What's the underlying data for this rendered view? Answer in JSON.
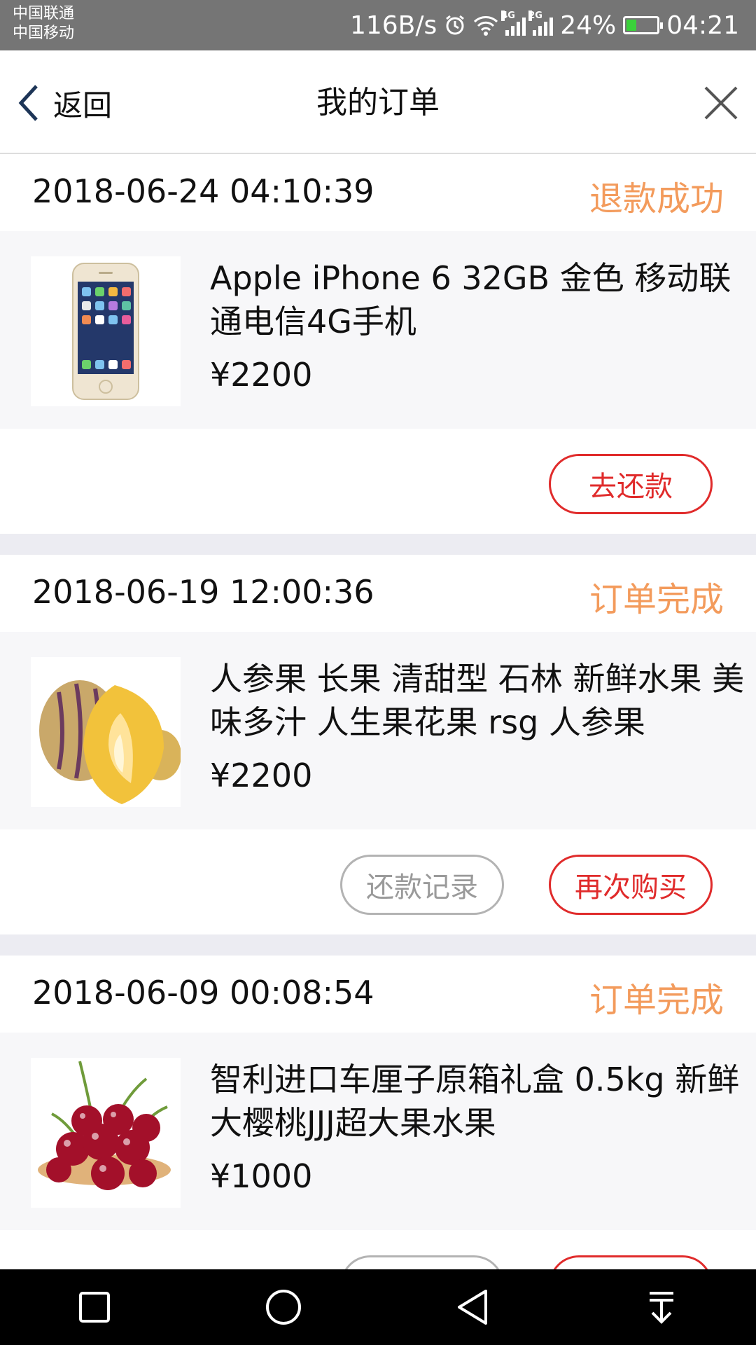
{
  "status_bar": {
    "carrier1": "中国联通",
    "carrier2": "中国移动",
    "net_speed": "116B/s",
    "net1": "4G",
    "net2": "2G",
    "battery": "24%",
    "time": "04:21"
  },
  "nav": {
    "back_label": "返回",
    "title": "我的订单"
  },
  "orders": [
    {
      "time": "2018-06-24 04:10:39",
      "status": "退款成功",
      "product_name": "Apple iPhone 6 32GB 金色 移动联通电信4G手机",
      "price": "¥2200",
      "image": "iphone-image",
      "actions": [
        "去还款"
      ]
    },
    {
      "time": "2018-06-19 12:00:36",
      "status": "订单完成",
      "product_name": "人参果 长果 清甜型 石林 新鲜水果 美味多汁 人生果花果 rsg 人参果",
      "price": "¥2200",
      "image": "pepino-fruit-image",
      "actions": [
        "还款记录",
        "再次购买"
      ]
    },
    {
      "time": "2018-06-09 00:08:54",
      "status": "订单完成",
      "product_name": "智利进口车厘子原箱礼盒 0.5kg 新鲜大樱桃JJJ超大果水果",
      "price": "¥1000",
      "image": "cherries-image",
      "actions": []
    }
  ],
  "colors": {
    "status_orange": "#f39b5c",
    "button_red": "#e02b2b",
    "button_gray": "#b3b3b3"
  }
}
